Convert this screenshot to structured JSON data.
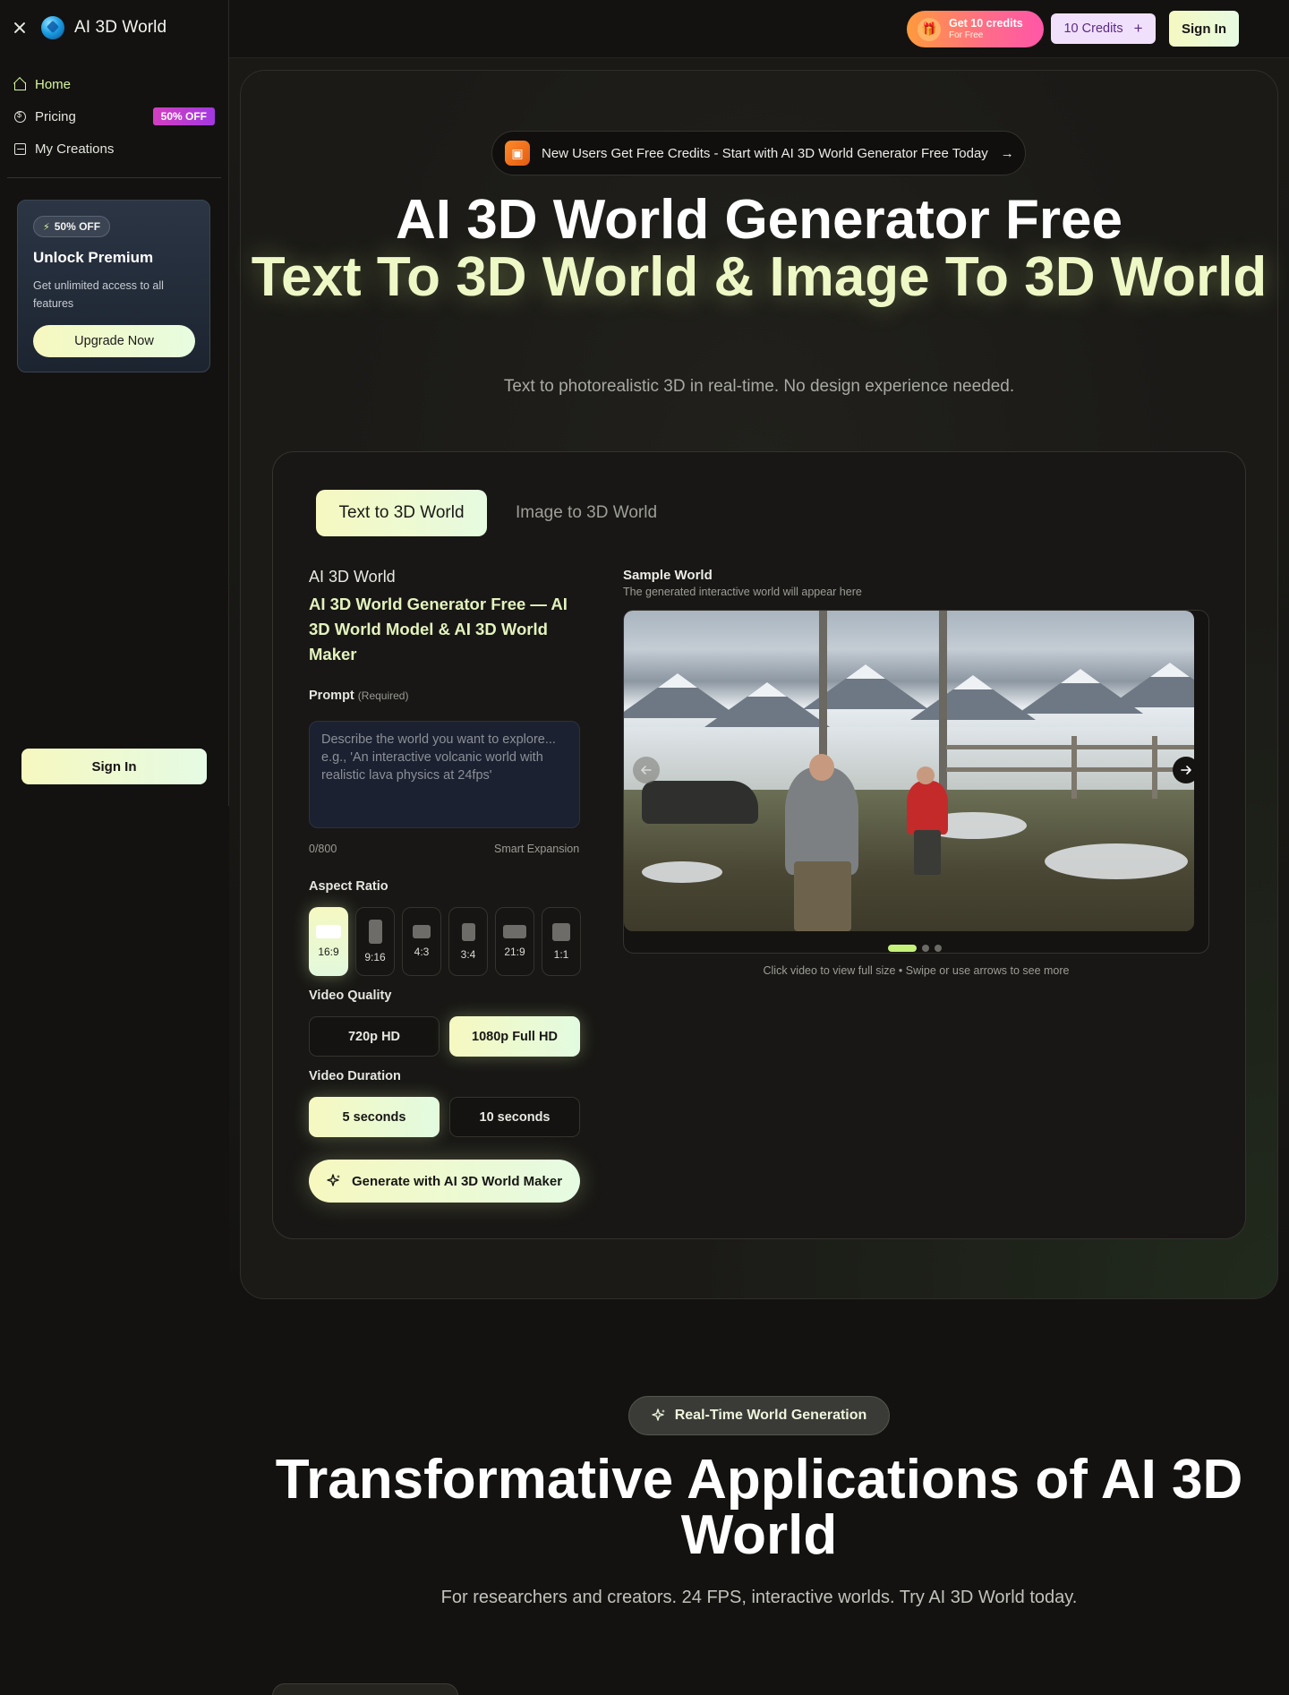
{
  "sidebar": {
    "brand": "AI 3D World",
    "nav": [
      {
        "label": "Home",
        "icon": "home-icon",
        "active": true
      },
      {
        "label": "Pricing",
        "icon": "pricing-icon",
        "badge": "50% OFF"
      },
      {
        "label": "My Creations",
        "icon": "image-icon"
      }
    ],
    "premium": {
      "badge": "50% OFF",
      "title": "Unlock Premium",
      "description": "Get unlimited access to all features",
      "button": "Upgrade Now"
    },
    "sign_in": "Sign In"
  },
  "topbar": {
    "get_credits_main": "Get 10 credits",
    "get_credits_sub": "For Free",
    "credits_label": "10 Credits",
    "credits_plus": "+",
    "sign_in": "Sign In"
  },
  "hero": {
    "announcement": "New Users Get Free Credits - Start with AI 3D World Generator Free Today",
    "announcement_arrow": "→",
    "title_line1": "AI 3D World Generator Free",
    "title_line2": "Text To 3D World & Image To 3D World",
    "subtitle": "Text to photorealistic 3D in real-time. No design experience needed."
  },
  "generator": {
    "tabs": [
      "Text to 3D World",
      "Image to 3D World"
    ],
    "kicker": "AI 3D World",
    "title": "AI 3D World Generator Free — AI 3D World Model & AI 3D World Maker",
    "prompt_label": "Prompt",
    "prompt_required": "(Required)",
    "prompt_placeholder": "Describe the world you want to explore... e.g., 'An interactive volcanic world with realistic lava physics at 24fps'",
    "char_count": "0/800",
    "smart_expansion": "Smart Expansion",
    "aspect_label": "Aspect Ratio",
    "aspect_ratios": [
      "16:9",
      "9:16",
      "4:3",
      "3:4",
      "21:9",
      "1:1"
    ],
    "aspect_selected": "16:9",
    "quality_label": "Video Quality",
    "quality_options": [
      "720p HD",
      "1080p Full HD"
    ],
    "quality_selected": "1080p Full HD",
    "duration_label": "Video Duration",
    "duration_options": [
      "5 seconds",
      "10 seconds"
    ],
    "duration_selected": "5 seconds",
    "generate_button": "Generate with AI 3D World Maker"
  },
  "sample": {
    "title": "Sample World",
    "subtitle": "The generated interactive world will appear here",
    "hint": "Click video to view full size • Swipe or use arrows to see more",
    "slide_count": 3,
    "active_slide": 1
  },
  "section2": {
    "pill": "Real-Time World Generation",
    "title": "Transformative Applications of AI 3D World",
    "subtitle": "For researchers and creators. 24 FPS, interactive worlds. Try AI 3D World today."
  },
  "colors": {
    "background": "#131210",
    "accent_gradient_start": "#f6f8bf",
    "accent_gradient_end": "#e5fbe2",
    "accent_text": "#eef8c6",
    "badge_purple": "#a238e0",
    "credits_orange": "#ff9a3d",
    "credits_pink": "#ff56a8"
  }
}
